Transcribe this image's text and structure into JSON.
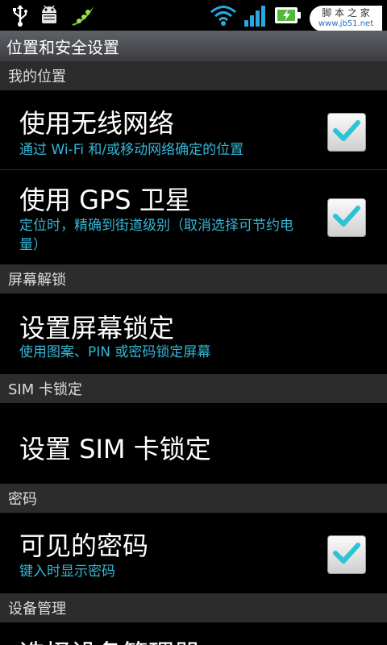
{
  "statusbar": {
    "icons": [
      "usb-icon",
      "android-debug-icon",
      "pea-pod-icon",
      "wifi-icon",
      "signal-icon",
      "battery-charging-icon"
    ],
    "watermark_line1": "脚 本 之 家",
    "watermark_line2": "www.jb51.net"
  },
  "header": {
    "title": "位置和安全设置"
  },
  "sections": {
    "my_location": "我的位置",
    "screen_unlock": "屏幕解锁",
    "sim_lock": "SIM 卡锁定",
    "password": "密码",
    "device_admin": "设备管理"
  },
  "items": {
    "wireless": {
      "title": "使用无线网络",
      "summary": "通过 Wi-Fi 和/或移动网络确定的位置",
      "checked": true
    },
    "gps": {
      "title": "使用 GPS 卫星",
      "summary": "定位时，精确到街道级别（取消选择可节约电量）",
      "checked": true
    },
    "screen_lock": {
      "title": "设置屏幕锁定",
      "summary": "使用图案、PIN 或密码锁定屏幕"
    },
    "sim": {
      "title": "设置 SIM 卡锁定"
    },
    "visible_password": {
      "title": "可见的密码",
      "summary": "键入时显示密码",
      "checked": true
    },
    "select_admin": {
      "title": "选择设备管理器"
    }
  },
  "colors": {
    "summary": "#34b7d6",
    "check": "#2bc3d6",
    "section_bg": "#2c2c2c"
  }
}
